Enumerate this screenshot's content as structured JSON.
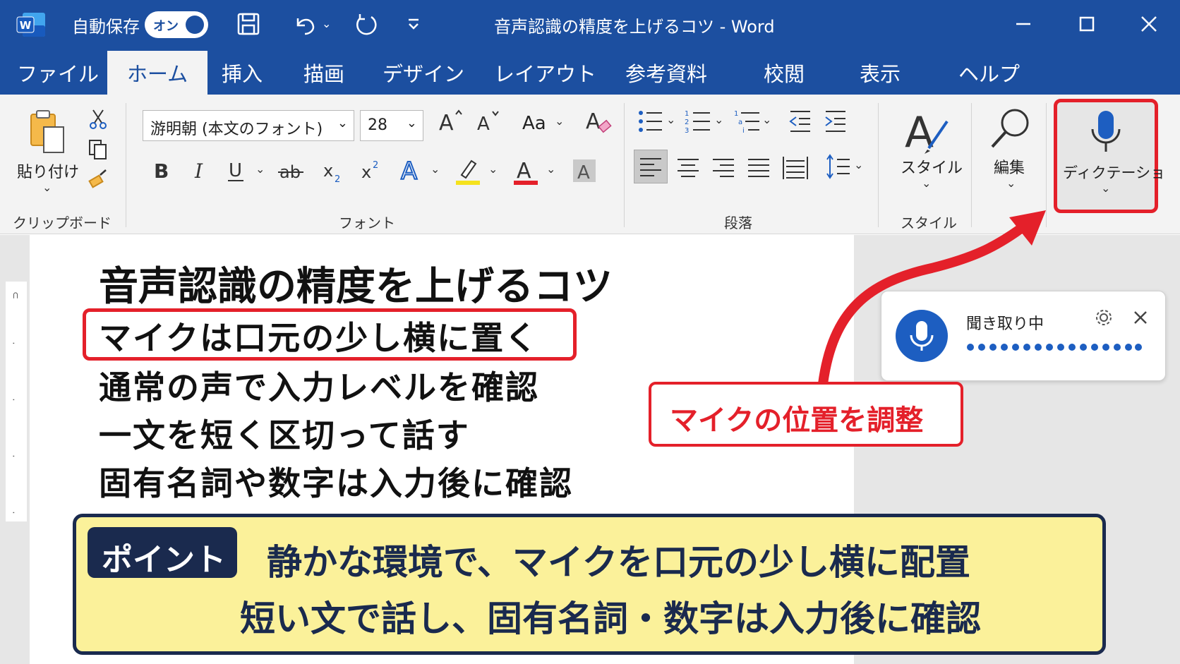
{
  "app": {
    "autosave_label": "自動保存",
    "toggle_label": "オン",
    "window_title": "音声認識の精度を上げるコツ  -  Word",
    "colors": {
      "title_bar": "#1c4fa0",
      "highlight": "#e4202a",
      "banner": "#fbf19a",
      "banner_dark": "#1a2a4e"
    }
  },
  "tabs": [
    {
      "label": "ファイル"
    },
    {
      "label": "ホーム"
    },
    {
      "label": "挿入"
    },
    {
      "label": "描画"
    },
    {
      "label": "デザイン"
    },
    {
      "label": "レイアウト"
    },
    {
      "label": "参考資料"
    },
    {
      "label": "校閲"
    },
    {
      "label": "表示"
    },
    {
      "label": "ヘルプ"
    }
  ],
  "ribbon": {
    "clipboard": {
      "paste_label": "貼り付け",
      "group_label": "クリップボード"
    },
    "font": {
      "font_name": "游明朝 (本文のフォント)",
      "font_size": "28",
      "case_label": "Aa",
      "group_label": "フォント"
    },
    "paragraph": {
      "group_label": "段落"
    },
    "styles": {
      "label": "スタイル",
      "group_label": "スタイル"
    },
    "editing": {
      "label": "編集"
    },
    "dictation": {
      "label": "ディクテーショ"
    }
  },
  "document": {
    "title": "音声認識の精度を上げるコツ",
    "lines": [
      "マイクは口元の少し横に置く",
      "通常の声で入力レベルを確認",
      "一文を短く区切って話す",
      "固有名詞や数字は入力後に確認"
    ]
  },
  "dictation_panel": {
    "status": "聞き取り中"
  },
  "callout": {
    "text": "マイクの位置を調整"
  },
  "point": {
    "badge": "ポイント",
    "line1": "静かな環境で、マイクを口元の少し横に配置",
    "line2": "短い文で話し、固有名詞・数字は入力後に確認"
  }
}
